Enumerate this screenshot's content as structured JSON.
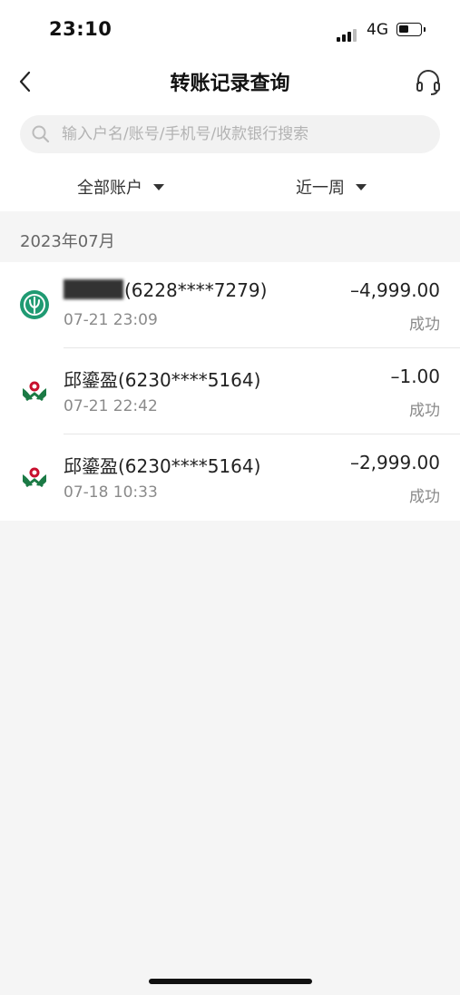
{
  "status_bar": {
    "time": "23:10",
    "network": "4G"
  },
  "header": {
    "title": "转账记录查询"
  },
  "search": {
    "placeholder": "输入户名/账号/手机号/收款银行搜索"
  },
  "filters": {
    "account": "全部账户",
    "period": "近一周"
  },
  "month_label": "2023年07月",
  "records": [
    {
      "name": "",
      "name_masked": true,
      "account": "(6228****7279)",
      "datetime": "07-21 23:09",
      "amount": "–4,999.00",
      "status": "成功",
      "bank_icon": "green-circle-bank-icon"
    },
    {
      "name": "邱鎏盈",
      "name_masked": false,
      "account": "(6230****5164)",
      "datetime": "07-21 22:42",
      "amount": "–1.00",
      "status": "成功",
      "bank_icon": "agricultural-bank-icon"
    },
    {
      "name": "邱鎏盈",
      "name_masked": false,
      "account": "(6230****5164)",
      "datetime": "07-18 10:33",
      "amount": "–2,999.00",
      "status": "成功",
      "bank_icon": "agricultural-bank-icon"
    }
  ],
  "colors": {
    "brand_green": "#1f9a72",
    "abc_green": "#1b7a45",
    "abc_red": "#c8102e"
  }
}
